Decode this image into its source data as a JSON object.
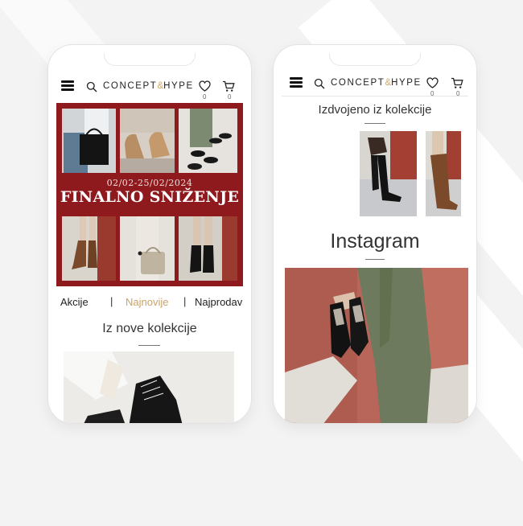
{
  "brand": {
    "logo_text_part1": "CONCEPT",
    "logo_amp": "&",
    "logo_text_part2": "HYPE",
    "accent_color": "#d1a96a",
    "banner_color": "#8e1a1e"
  },
  "header": {
    "wishlist_count": "0",
    "cart_count": "0",
    "icons": [
      "menu-icon",
      "search-icon",
      "heart-icon",
      "cart-icon"
    ]
  },
  "left_phone": {
    "banner": {
      "dates": "02/02-25/02/2024",
      "title": "FINALNO SNIŽENJE"
    },
    "tabs": [
      {
        "label": "Akcije"
      },
      {
        "label": "Najnovije",
        "active": true
      },
      {
        "label": "Najprodavanije"
      }
    ],
    "tab_separator": "|",
    "section_title": "Iz nove kolekcije"
  },
  "right_phone": {
    "featured_title": "Izdvojeno iz kolekcije",
    "instagram_title": "Instagram"
  }
}
